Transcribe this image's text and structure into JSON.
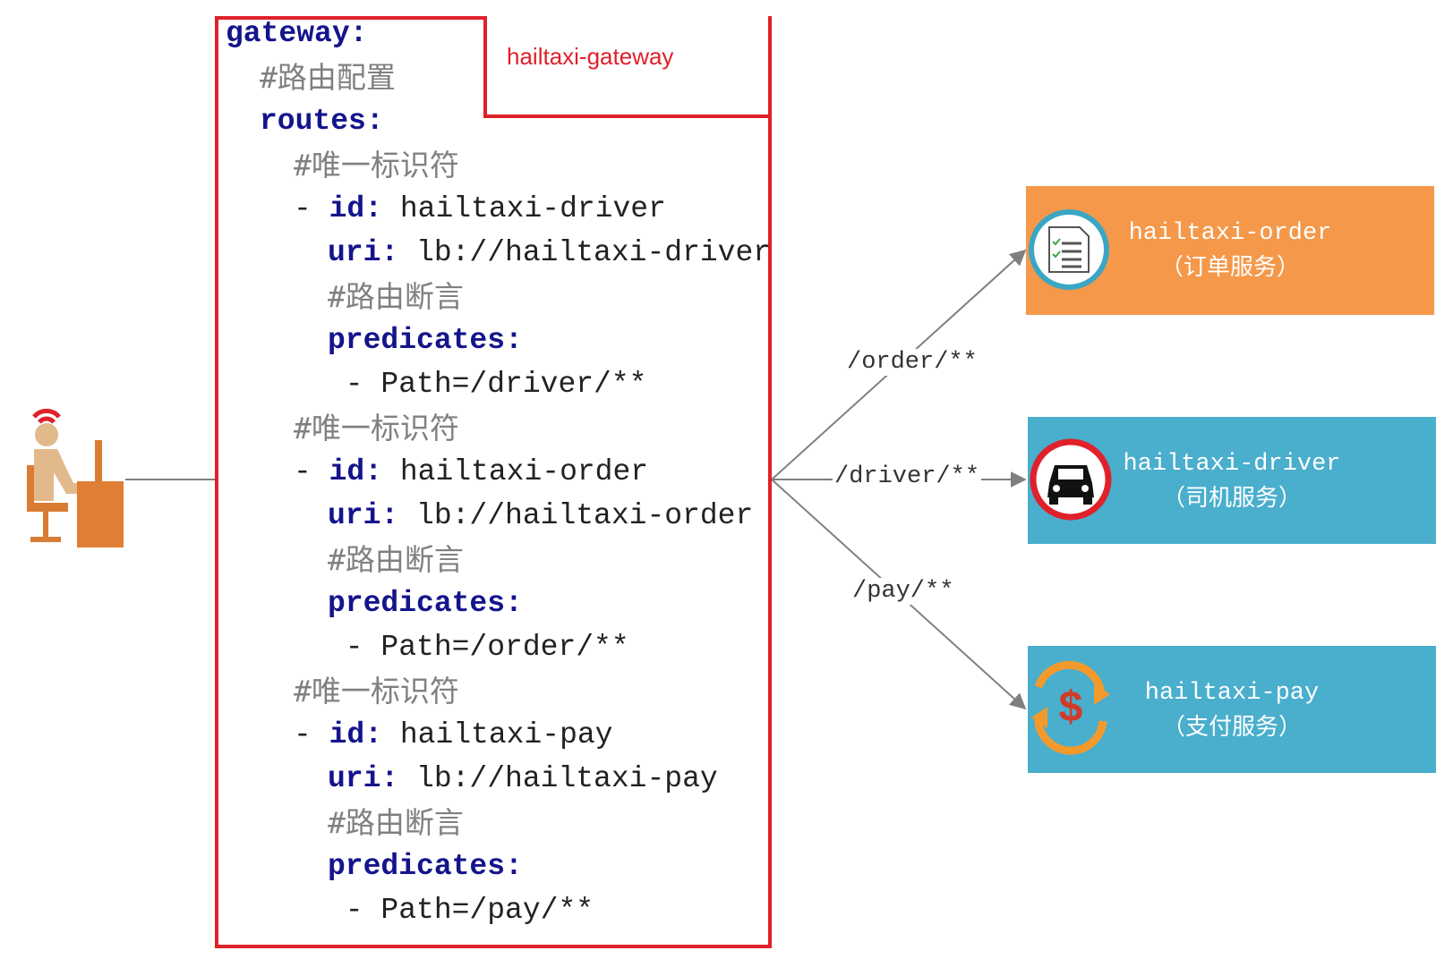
{
  "gateway": {
    "name_label": "hailtaxi-gateway",
    "lines": [
      {
        "indent": 0,
        "type": "key",
        "text": "gateway:"
      },
      {
        "indent": 2,
        "type": "comment",
        "text": "#路由配置"
      },
      {
        "indent": 2,
        "type": "key",
        "text": "routes:"
      },
      {
        "indent": 4,
        "type": "comment",
        "text": "#唯一标识符"
      },
      {
        "indent": 4,
        "type": "pair",
        "prefix": "- ",
        "key": "id:",
        "value": " hailtaxi-driver"
      },
      {
        "indent": 6,
        "type": "pair",
        "prefix": "",
        "key": "uri:",
        "value": " lb://hailtaxi-driver"
      },
      {
        "indent": 6,
        "type": "comment",
        "text": "#路由断言"
      },
      {
        "indent": 6,
        "type": "key",
        "text": "predicates:"
      },
      {
        "indent": 6,
        "type": "plain",
        "text": " - Path=/driver/**"
      },
      {
        "indent": 4,
        "type": "comment",
        "text": "#唯一标识符"
      },
      {
        "indent": 4,
        "type": "pair",
        "prefix": "- ",
        "key": "id:",
        "value": " hailtaxi-order"
      },
      {
        "indent": 6,
        "type": "pair",
        "prefix": "",
        "key": "uri:",
        "value": " lb://hailtaxi-order"
      },
      {
        "indent": 6,
        "type": "comment",
        "text": "#路由断言"
      },
      {
        "indent": 6,
        "type": "key",
        "text": "predicates:"
      },
      {
        "indent": 6,
        "type": "plain",
        "text": " - Path=/order/**"
      },
      {
        "indent": 4,
        "type": "comment",
        "text": "#唯一标识符"
      },
      {
        "indent": 4,
        "type": "pair",
        "prefix": "- ",
        "key": "id:",
        "value": " hailtaxi-pay"
      },
      {
        "indent": 6,
        "type": "pair",
        "prefix": "",
        "key": "uri:",
        "value": " lb://hailtaxi-pay"
      },
      {
        "indent": 6,
        "type": "comment",
        "text": "#路由断言"
      },
      {
        "indent": 6,
        "type": "key",
        "text": "predicates:"
      },
      {
        "indent": 6,
        "type": "plain",
        "text": " - Path=/pay/**"
      }
    ]
  },
  "routes": [
    {
      "label": "/order/**",
      "target": "order"
    },
    {
      "label": "/driver/**",
      "target": "driver"
    },
    {
      "label": "/pay/**",
      "target": "pay"
    }
  ],
  "services": {
    "order": {
      "title": "hailtaxi-order",
      "subtitle": "（订单服务）",
      "color": "#f5984a",
      "icon": "document-icon"
    },
    "driver": {
      "title": "hailtaxi-driver",
      "subtitle": "（司机服务）",
      "color": "#4aaecd",
      "icon": "car-icon"
    },
    "pay": {
      "title": "hailtaxi-pay",
      "subtitle": "（支付服务）",
      "color": "#4aaecd",
      "icon": "dollar-cycle-icon"
    }
  },
  "colors": {
    "frame": "#e0202a",
    "key": "#14148c",
    "comment": "#808080",
    "arrow": "#7f7f7f"
  }
}
